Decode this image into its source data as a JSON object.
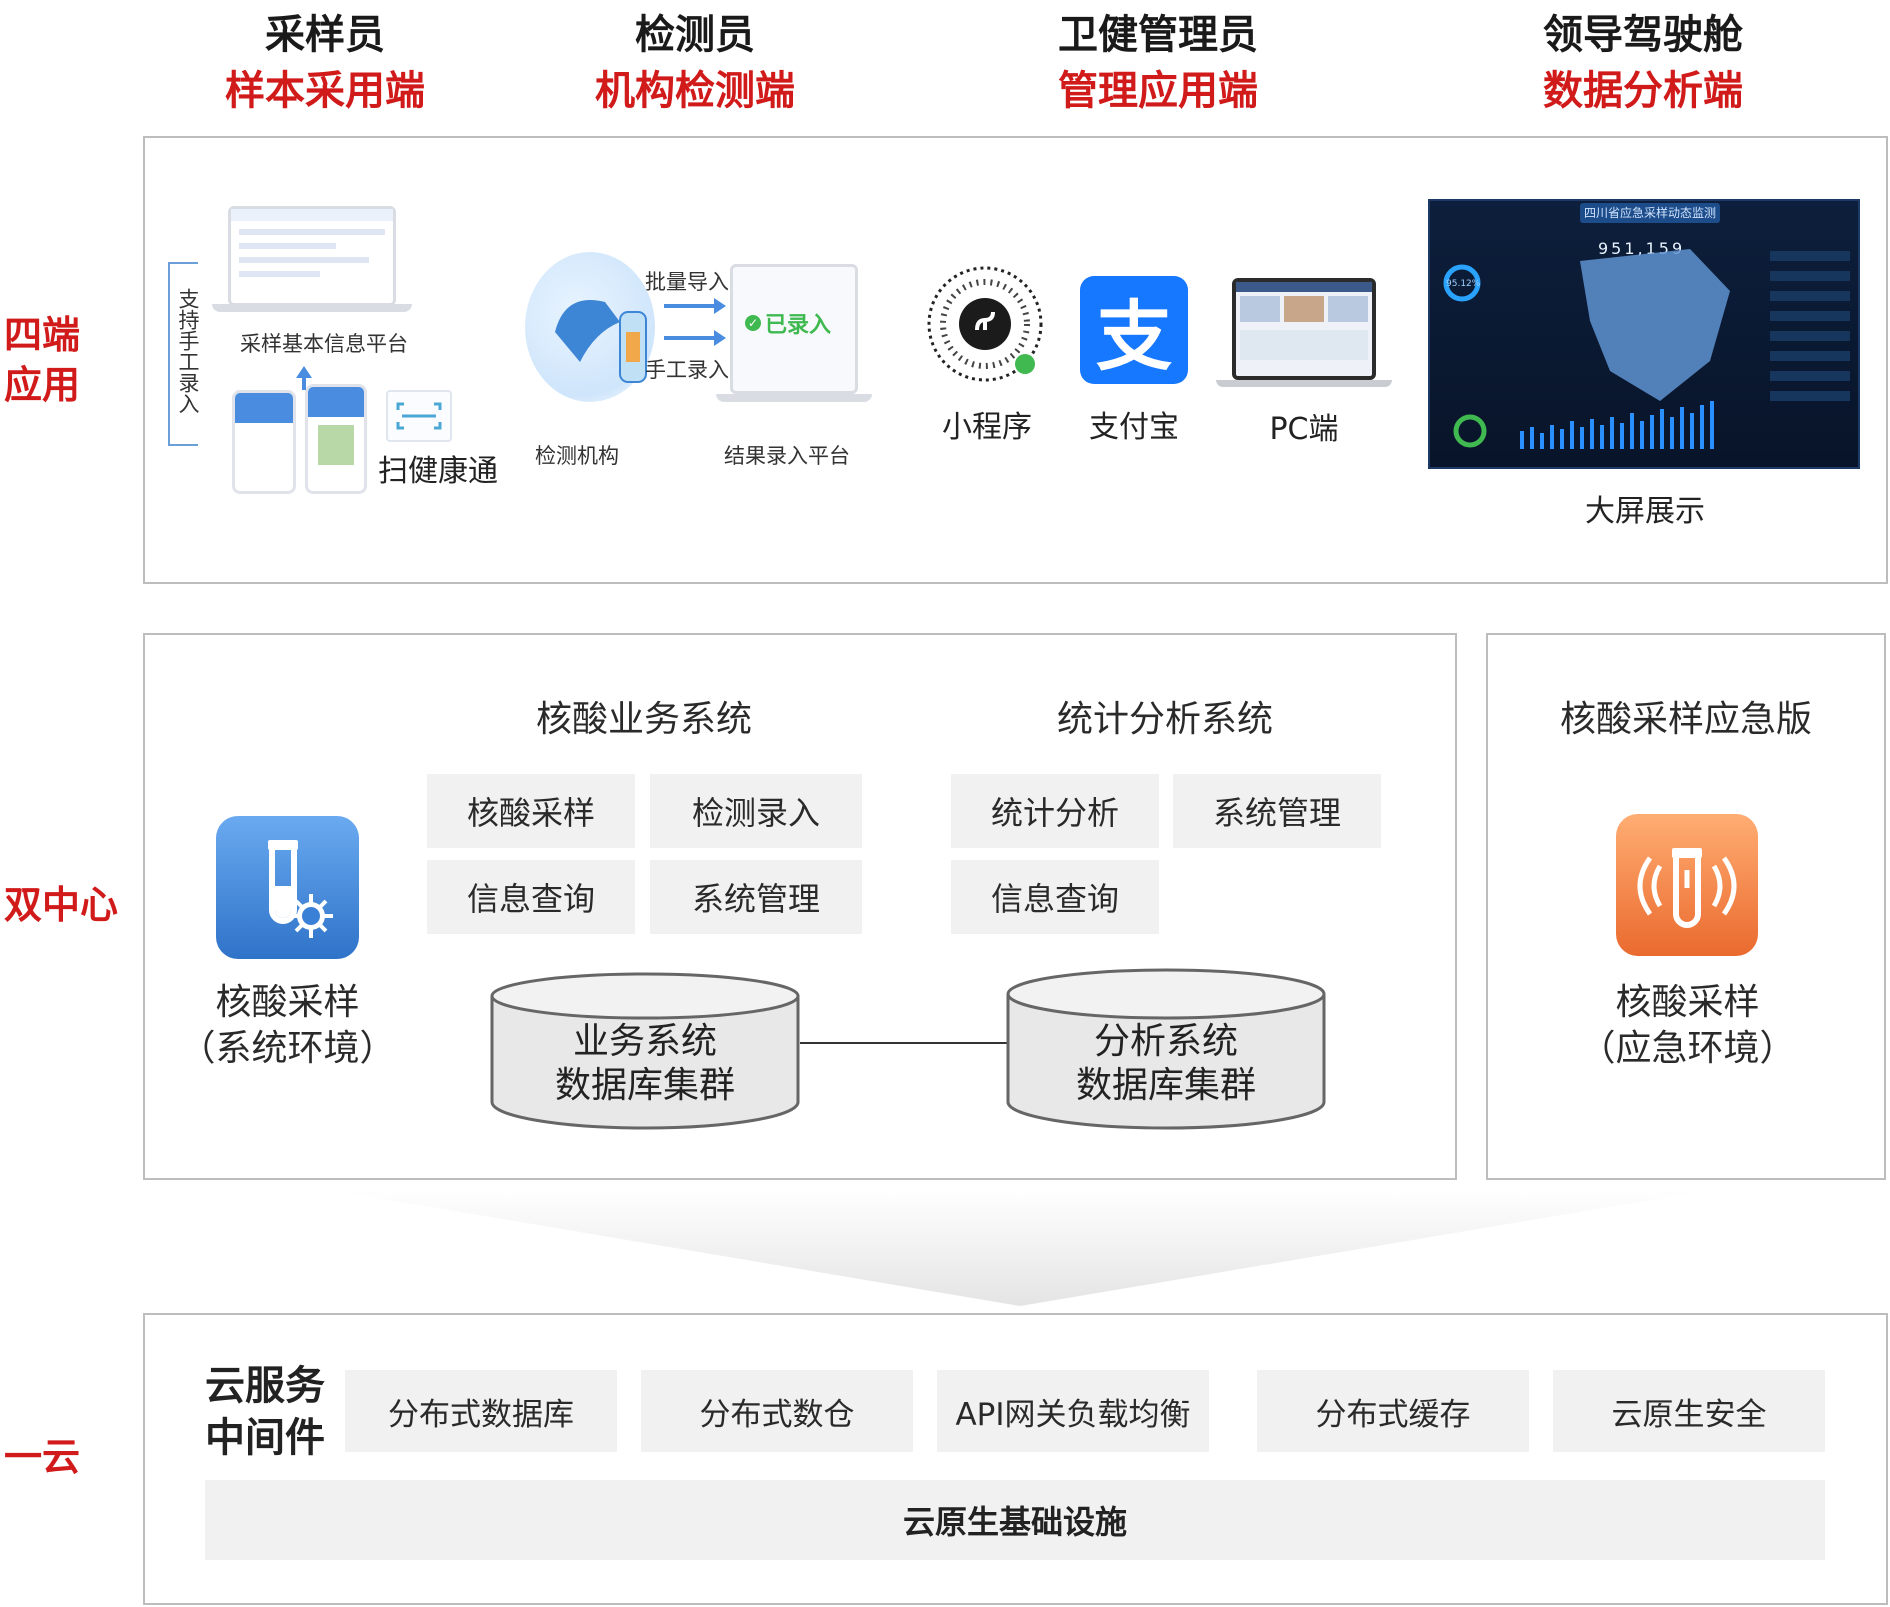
{
  "roles": [
    {
      "name": "采样员",
      "terminal": "样本采用端"
    },
    {
      "name": "检测员",
      "terminal": "机构检测端"
    },
    {
      "name": "卫健管理员",
      "terminal": "管理应用端"
    },
    {
      "name": "领导驾驶舱",
      "terminal": "数据分析端"
    }
  ],
  "side_labels": {
    "four": "四端\n应用",
    "dual": "双中心",
    "cloud": "一云"
  },
  "apps": {
    "manual_entry": "支持手工录入",
    "sampling_platform": "采样基本信息平台",
    "scan_health_code": "扫健康通",
    "batch_import": "批量导入",
    "manual_import": "手工录入",
    "lab": "检测机构",
    "result_platform": "结果录入平台",
    "entered_badge": "已录入",
    "mini_program": "小程序",
    "alipay": "支付宝",
    "alipay_glyph": "支",
    "pc": "PC端",
    "big_screen": "大屏展示",
    "dashboard_title": "四川省应急采样动态监测",
    "dashboard_number": "951,159",
    "dashboard_percent": "95.12%"
  },
  "center": {
    "icon_label_1": "核酸采样",
    "icon_label_2": "（系统环境）",
    "business_title": "核酸业务系统",
    "business_modules": [
      "核酸采样",
      "检测录入",
      "信息查询",
      "系统管理"
    ],
    "stats_title": "统计分析系统",
    "stats_modules": [
      "统计分析",
      "系统管理",
      "信息查询"
    ],
    "db1_line1": "业务系统",
    "db1_line2": "数据库集群",
    "db2_line1": "分析系统",
    "db2_line2": "数据库集群"
  },
  "emergency": {
    "title": "核酸采样应急版",
    "label_1": "核酸采样",
    "label_2": "（应急环境）"
  },
  "cloud": {
    "middleware_1": "云服务",
    "middleware_2": "中间件",
    "items": [
      "分布式数据库",
      "分布式数仓",
      "API网关负载均衡",
      "分布式缓存",
      "云原生安全"
    ],
    "infra": "云原生基础设施"
  },
  "colors": {
    "accent_red": "#d11a1a",
    "box_gray": "#f1f1f1",
    "border": "#bdbdbd",
    "blue_icon": "#3d86d6",
    "orange_icon": "#f07a3c",
    "alipay_blue": "#1677ff"
  }
}
